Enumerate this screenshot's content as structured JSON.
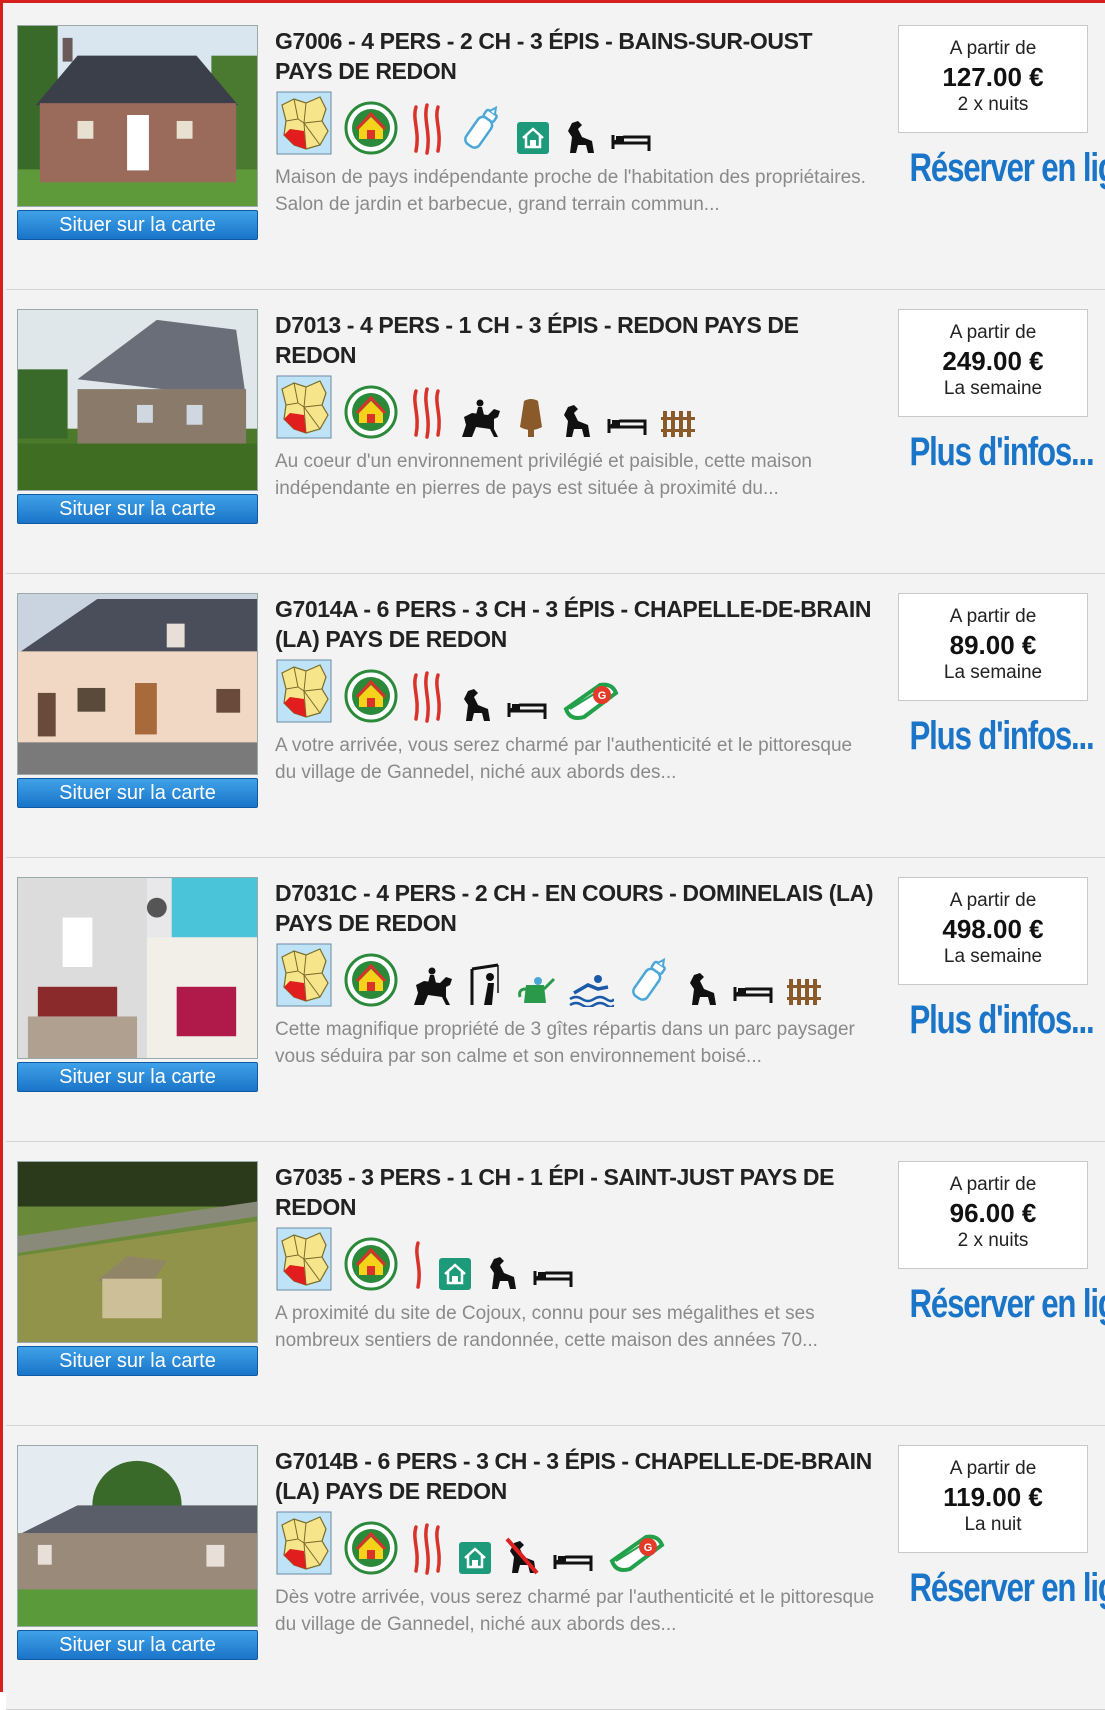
{
  "listings": [
    {
      "title": "G7006 - 4 PERS - 2 CH - 3 ÉPIS - BAINS-SUR-OUST PAYS DE REDON",
      "description": "Maison de pays indépendante proche de l'habitation des propriétaires. Salon de jardin et barbecue, grand terrain commun...",
      "price_from": "A partir de",
      "price": "127.00 €",
      "price_unit": "2 x nuits",
      "cta": "Réserver en ligne",
      "map_button": "Situer sur la carte",
      "photo": "house-stone-red-shutters",
      "icons": [
        "region-map-icon",
        "gites-de-france-icon",
        "epis-3-icon",
        "baby-bottle-icon",
        "home-icon",
        "pet-icon",
        "bed-icon"
      ]
    },
    {
      "title": "D7013 - 4 PERS - 1 CH - 3 ÉPIS - REDON PAYS DE REDON",
      "description": "Au coeur d'un environnement privilégié et paisible, cette maison indépendante en pierres de pays est située à proximité du...",
      "price_from": "A partir de",
      "price": "249.00 €",
      "price_unit": "La semaine",
      "cta": "Plus d'infos...",
      "map_button": "Situer sur la carte",
      "photo": "house-stone-garden",
      "icons": [
        "region-map-icon",
        "gites-de-france-icon",
        "epis-3-icon",
        "horse-riding-icon",
        "cheese-icon",
        "pet-icon",
        "bed-icon",
        "fence-icon"
      ]
    },
    {
      "title": "G7014A - 6 PERS - 3 CH - 3 ÉPIS - CHAPELLE-DE-BRAIN (LA) PAYS DE REDON",
      "description": "A votre arrivée, vous serez charmé par l'authenticité et le pittoresque du village de Gannedel, niché aux abords des...",
      "price_from": "A partir de",
      "price": "89.00 €",
      "price_unit": "La semaine",
      "cta": "Plus d'infos...",
      "map_button": "Situer sur la carte",
      "photo": "house-beige-render",
      "icons": [
        "region-map-icon",
        "gites-de-france-icon",
        "epis-3-icon",
        "pet-icon",
        "bed-icon",
        "green-label-icon"
      ]
    },
    {
      "title": "D7031C - 4 PERS - 2 CH - EN COURS - DOMINELAIS (LA) PAYS DE REDON",
      "description": "Cette magnifique propriété de 3 gîtes répartis dans un parc paysager vous séduira par son calme et son environnement boisé...",
      "price_from": "A partir de",
      "price": "498.00 €",
      "price_unit": "La semaine",
      "cta": "Plus d'infos...",
      "map_button": "Situer sur la carte",
      "photo": "interior-collage",
      "icons": [
        "region-map-icon",
        "gites-de-france-icon",
        "horse-riding-icon",
        "fishing-icon",
        "watering-can-icon",
        "swimming-icon",
        "baby-bottle-icon",
        "pet-icon",
        "bed-icon",
        "fence-icon"
      ]
    },
    {
      "title": "G7035 - 3 PERS - 1 CH - 1 ÉPI - SAINT-JUST PAYS DE REDON",
      "description": "A proximité du site de Cojoux, connu pour ses mégalithes et ses nombreux sentiers de randonnée, cette maison des années 70...",
      "price_from": "A partir de",
      "price": "96.00 €",
      "price_unit": "2 x nuits",
      "cta": "Réserver en ligne",
      "map_button": "Situer sur la carte",
      "photo": "aerial-house",
      "icons": [
        "region-map-icon",
        "gites-de-france-icon",
        "epis-1-icon",
        "home-icon",
        "pet-icon",
        "bed-icon"
      ]
    },
    {
      "title": "G7014B - 6 PERS - 3 CH - 3 ÉPIS - CHAPELLE-DE-BRAIN (LA) PAYS DE REDON",
      "description": "Dès votre arrivée, vous serez charmé par l'authenticité et le pittoresque du village de Gannedel, niché aux abords des...",
      "price_from": "A partir de",
      "price": "119.00 €",
      "price_unit": "La nuit",
      "cta": "Réserver en ligne",
      "map_button": "Situer sur la carte",
      "photo": "stone-house-tree",
      "icons": [
        "region-map-icon",
        "gites-de-france-icon",
        "epis-3-icon",
        "home-icon",
        "no-pets-icon",
        "bed-icon",
        "green-label-icon"
      ]
    }
  ],
  "colors": {
    "frame_border": "#d62020",
    "button_blue": "#1a74c8",
    "cta_blue": "#1a74c8",
    "description_gray": "#8a8a8a",
    "wheat_red": "#d9322a",
    "gites_green": "#2a8a3a"
  }
}
